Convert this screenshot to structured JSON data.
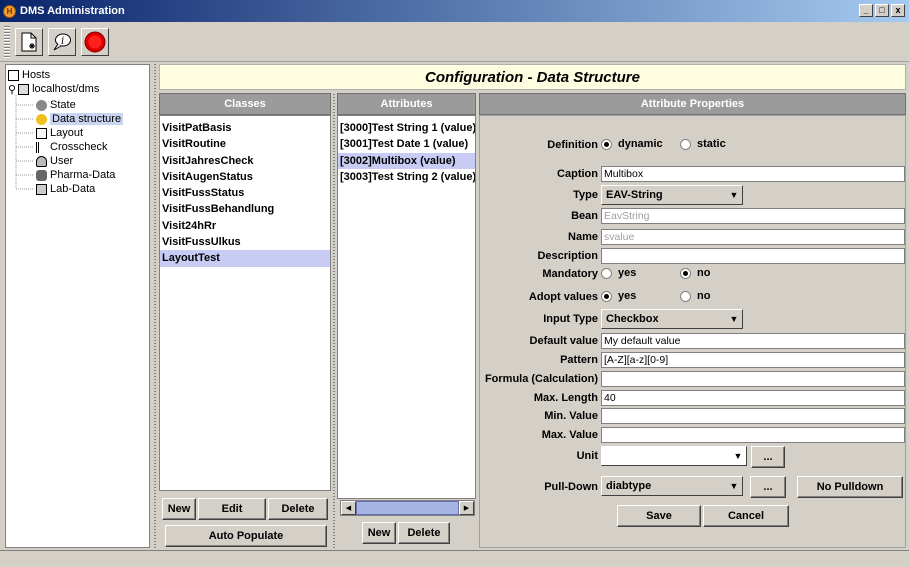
{
  "window": {
    "title": "DMS Administration",
    "min": "_",
    "max": "□",
    "close": "x"
  },
  "tree": {
    "root": "Hosts",
    "host": "localhost/dms",
    "items": [
      "State",
      "Data structure",
      "Layout",
      "Crosscheck",
      "User",
      "Pharma-Data",
      "Lab-Data"
    ],
    "selected": "Data structure"
  },
  "header": {
    "title": "Configuration - Data Structure"
  },
  "classes": {
    "heading": "Classes",
    "items": [
      "VisitPatBasis",
      "VisitRoutine",
      "VisitJahresCheck",
      "VisitAugenStatus",
      "VisitFussStatus",
      "VisitFussBehandlung",
      "Visit24hRr",
      "VisitFussUlkus",
      "LayoutTest"
    ],
    "selected": "LayoutTest",
    "new": "New",
    "edit": "Edit",
    "delete": "Delete",
    "auto": "Auto Populate"
  },
  "attributes": {
    "heading": "Attributes",
    "items": [
      "[3000]Test String 1 (value)",
      "[3001]Test Date 1 (value)",
      "[3002]Multibox (value)",
      "[3003]Test String 2 (value)"
    ],
    "selected": "[3002]Multibox (value)",
    "new": "New",
    "delete": "Delete"
  },
  "props": {
    "heading": "Attribute Properties",
    "definition_label": "Definition",
    "dynamic": "dynamic",
    "static": "static",
    "caption_label": "Caption",
    "caption": "Multibox",
    "type_label": "Type",
    "type": "EAV-String",
    "bean_label": "Bean",
    "bean": "EavString",
    "name_label": "Name",
    "name": "svalue",
    "description_label": "Description",
    "description": "",
    "mandatory_label": "Mandatory",
    "yes": "yes",
    "no": "no",
    "adopt_label": "Adopt values",
    "input_type_label": "Input Type",
    "input_type": "Checkbox",
    "default_label": "Default value",
    "default": "My default value",
    "pattern_label": "Pattern",
    "pattern": "[A-Z][a-z][0-9]",
    "formula_label": "Formula (Calculation)",
    "formula": "",
    "maxlen_label": "Max. Length",
    "maxlen": "40",
    "minval_label": "Min. Value",
    "minval": "",
    "maxval_label": "Max. Value",
    "maxval": "",
    "unit_label": "Unit",
    "unit": "",
    "pulldown_label": "Pull-Down",
    "pulldown": "diabtype",
    "ellipsis": "...",
    "no_pulldown": "No Pulldown",
    "save": "Save",
    "cancel": "Cancel"
  }
}
